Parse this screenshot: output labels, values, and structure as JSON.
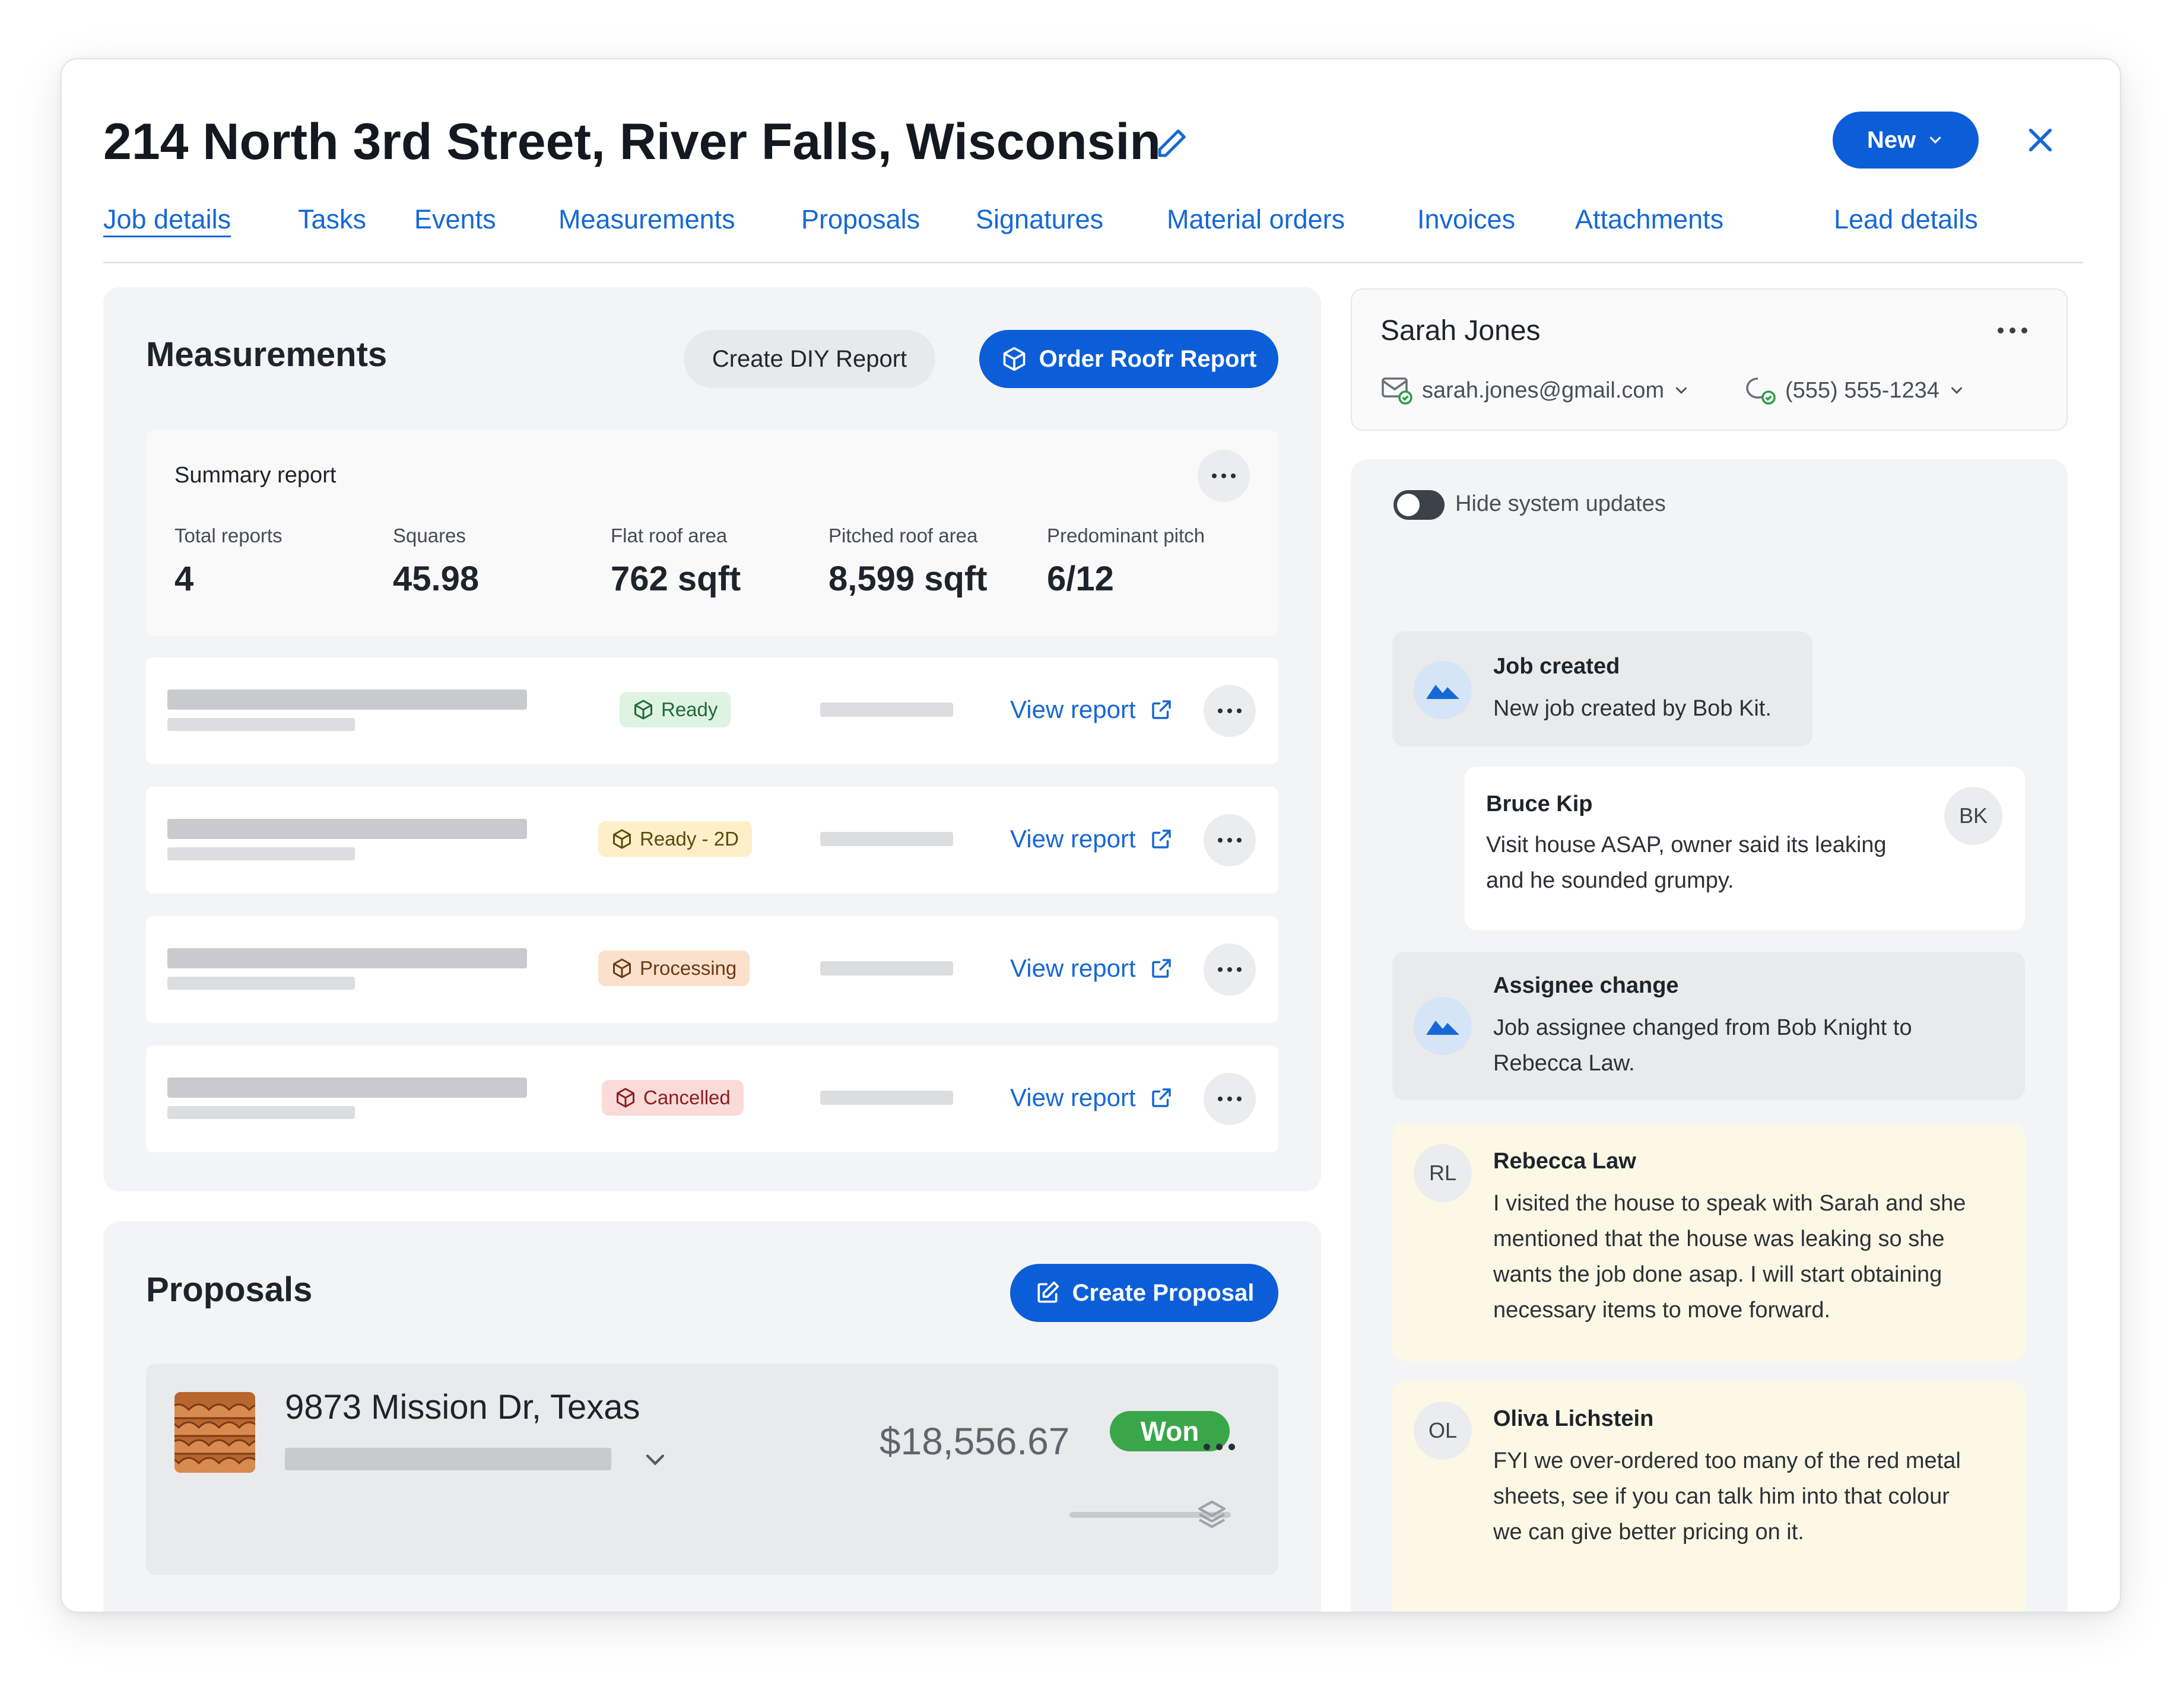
{
  "header": {
    "title": "214 North 3rd Street, River Falls, Wisconsin",
    "new_label": "New",
    "icons": {
      "edit": "pencil-icon",
      "close": "close-icon",
      "chevron": "chevron-down-icon"
    }
  },
  "tabs": [
    {
      "label": "Job details",
      "active": true
    },
    {
      "label": "Tasks"
    },
    {
      "label": "Events"
    },
    {
      "label": "Measurements"
    },
    {
      "label": "Proposals"
    },
    {
      "label": "Signatures"
    },
    {
      "label": "Material orders"
    },
    {
      "label": "Invoices"
    },
    {
      "label": "Attachments"
    },
    {
      "label": "Lead details"
    }
  ],
  "measurements": {
    "title": "Measurements",
    "diy_label": "Create DIY Report",
    "order_label": "Order Roofr Report",
    "summary": {
      "title": "Summary report",
      "stats": [
        {
          "label": "Total reports",
          "value": "4"
        },
        {
          "label": "Squares",
          "value": "45.98"
        },
        {
          "label": "Flat roof area",
          "value": "762 sqft"
        },
        {
          "label": "Pitched roof area",
          "value": "8,599 sqft"
        },
        {
          "label": "Predominant pitch",
          "value": "6/12"
        }
      ]
    },
    "reports": [
      {
        "status": "Ready",
        "bg": "#dff3e3",
        "fg": "#1f6b34",
        "link": "View report"
      },
      {
        "status": "Ready - 2D",
        "bg": "#fdf0c8",
        "fg": "#5b4a12",
        "link": "View report"
      },
      {
        "status": "Processing",
        "bg": "#fbe1cc",
        "fg": "#6b3a14",
        "link": "View report"
      },
      {
        "status": "Cancelled",
        "bg": "#fbdada",
        "fg": "#8a1f1f",
        "link": "View report"
      }
    ]
  },
  "proposals": {
    "title": "Proposals",
    "create_label": "Create Proposal",
    "item": {
      "address": "9873 Mission Dr, Texas",
      "amount": "$18,556.67",
      "status": "Won"
    }
  },
  "contact": {
    "name": "Sarah Jones",
    "email": "sarah.jones@gmail.com",
    "phone": "(555) 555-1234"
  },
  "feed": {
    "toggle_label": "Hide system updates",
    "items": [
      {
        "title": "Job created",
        "text": "New job created by Bob Kit."
      },
      {
        "title": "Bruce Kip",
        "initials": "BK",
        "text_lines": [
          "Visit house ASAP, owner said its leaking",
          "and he sounded grumpy."
        ]
      },
      {
        "title": "Assignee change",
        "text_lines": [
          "Job assignee changed from Bob Knight to",
          "Rebecca Law."
        ]
      },
      {
        "title": "Rebecca Law",
        "initials": "RL",
        "text_lines": [
          "I visited the house to speak with Sarah and she",
          "mentioned that the house was leaking so she",
          "wants the job done asap. I will start obtaining",
          "necessary items to move forward."
        ]
      },
      {
        "title": "Oliva Lichstein",
        "initials": "OL",
        "text_lines": [
          "FYI we over-ordered too many of the red metal",
          "sheets, see if you can talk him into that colour",
          "we can give better pricing on it."
        ]
      }
    ]
  },
  "colors": {
    "accent": "#0b5ed7",
    "link": "#1668d6",
    "won": "#3aa64a",
    "note_bg": "#fdf8e6"
  }
}
